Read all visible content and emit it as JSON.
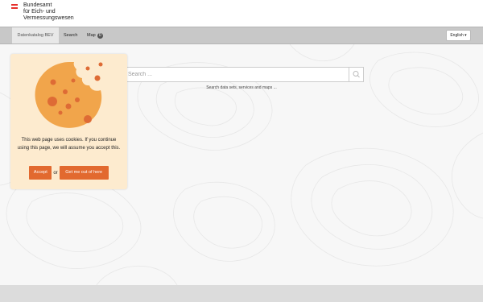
{
  "header": {
    "org_lines": [
      "Bundesamt",
      "für Eich- und",
      "Vermessungswesen"
    ],
    "flag_colors": [
      "#e6302c",
      "#ffffff",
      "#e6302c"
    ]
  },
  "navbar": {
    "items": [
      {
        "label": "Datenkatalog BEV",
        "active": true
      },
      {
        "label": "Search"
      },
      {
        "label": "Map",
        "badge": "0"
      }
    ],
    "language": {
      "label": "English",
      "icon": "caret-down-icon"
    }
  },
  "search": {
    "placeholder": "Search ...",
    "value": "",
    "hint": "Search data sets, services and maps ...",
    "button_icon": "search-icon"
  },
  "cookie_popup": {
    "image_icon": "cookie-icon",
    "message": "This web page uses cookies. If you continue using this page, we will assume you accept this.",
    "accept_label": "Accept",
    "or_label": "or",
    "decline_label": "Get me out of here"
  },
  "colors": {
    "accent": "#e2692f",
    "navbar_bg": "#c8c8c8",
    "cookie_bg": "#fdebcf",
    "cookie_fill": "#f1a54b",
    "crumb_spots": "#de6b35"
  }
}
